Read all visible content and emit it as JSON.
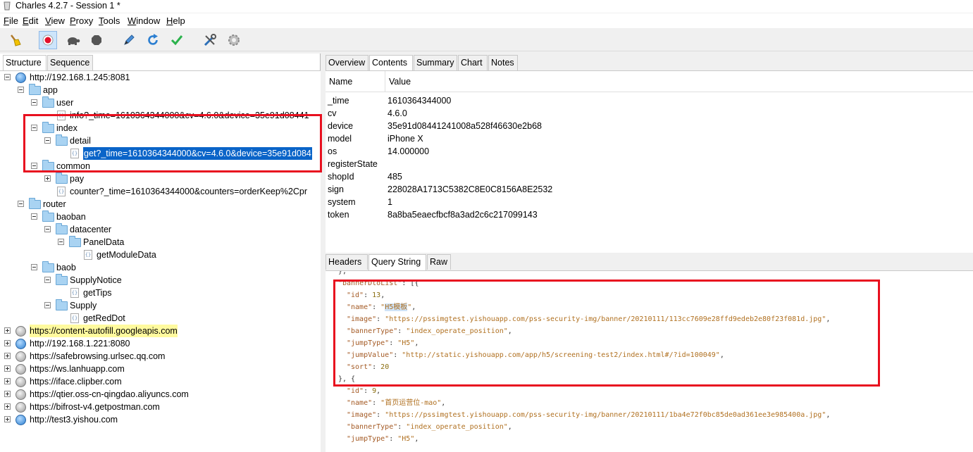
{
  "window": {
    "title": "Charles 4.2.7 - Session 1 *"
  },
  "menu": [
    {
      "mn": "F",
      "rest": "ile"
    },
    {
      "mn": "E",
      "rest": "dit"
    },
    {
      "mn": "V",
      "rest": "iew"
    },
    {
      "mn": "P",
      "rest": "roxy"
    },
    {
      "mn": "T",
      "rest": "ools"
    },
    {
      "mn": "W",
      "rest": "indow"
    },
    {
      "mn": "H",
      "rest": "elp"
    }
  ],
  "toolbar": {
    "icons": [
      "broom-icon",
      "record-icon",
      "turtle-icon",
      "stop-icon",
      "pen-icon",
      "refresh-icon",
      "check-icon",
      "tools-icon",
      "settings-icon"
    ]
  },
  "left_tabs": [
    "Structure",
    "Sequence"
  ],
  "tree": [
    {
      "depth": 0,
      "icon": "globe",
      "exp": "minus",
      "label": "http://192.168.1.245:8081"
    },
    {
      "depth": 1,
      "icon": "folder",
      "exp": "minus",
      "label": "app"
    },
    {
      "depth": 2,
      "icon": "folder",
      "exp": "minus",
      "label": "user"
    },
    {
      "depth": 3,
      "icon": "file",
      "exp": "",
      "label": "info?_time=1610364344000&cv=4.6.0&device=35e91d08441"
    },
    {
      "depth": 2,
      "icon": "folder",
      "exp": "minus",
      "label": "index"
    },
    {
      "depth": 3,
      "icon": "folder",
      "exp": "minus",
      "label": "detail"
    },
    {
      "depth": 4,
      "icon": "file",
      "exp": "",
      "label": "get?_time=1610364344000&cv=4.6.0&device=35e91d084",
      "selected": true
    },
    {
      "depth": 2,
      "icon": "folder",
      "exp": "minus",
      "label": "common"
    },
    {
      "depth": 3,
      "icon": "folder",
      "exp": "plus",
      "label": "pay"
    },
    {
      "depth": 3,
      "icon": "file",
      "exp": "",
      "label": "counter?_time=1610364344000&counters=orderKeep%2Cpr"
    },
    {
      "depth": 1,
      "icon": "folder",
      "exp": "minus",
      "label": "router"
    },
    {
      "depth": 2,
      "icon": "folder",
      "exp": "minus",
      "label": "baoban"
    },
    {
      "depth": 3,
      "icon": "folder",
      "exp": "minus",
      "label": "datacenter"
    },
    {
      "depth": 4,
      "icon": "folder",
      "exp": "minus",
      "label": "PanelData"
    },
    {
      "depth": 5,
      "icon": "file",
      "exp": "",
      "label": "getModuleData"
    },
    {
      "depth": 2,
      "icon": "folder",
      "exp": "minus",
      "label": "baob"
    },
    {
      "depth": 3,
      "icon": "folder",
      "exp": "minus",
      "label": "SupplyNotice"
    },
    {
      "depth": 4,
      "icon": "file",
      "exp": "",
      "label": "getTips"
    },
    {
      "depth": 3,
      "icon": "folder",
      "exp": "minus",
      "label": "Supply"
    },
    {
      "depth": 4,
      "icon": "file",
      "exp": "",
      "label": "getRedDot"
    },
    {
      "depth": 0,
      "icon": "lock",
      "exp": "plus",
      "label": "https://content-autofill.googleapis.com",
      "highlight": true
    },
    {
      "depth": 0,
      "icon": "globe",
      "exp": "plus",
      "label": "http://192.168.1.221:8080"
    },
    {
      "depth": 0,
      "icon": "lock",
      "exp": "plus",
      "label": "https://safebrowsing.urlsec.qq.com"
    },
    {
      "depth": 0,
      "icon": "lock",
      "exp": "plus",
      "label": "https://ws.lanhuapp.com"
    },
    {
      "depth": 0,
      "icon": "lock",
      "exp": "plus",
      "label": "https://iface.clipber.com"
    },
    {
      "depth": 0,
      "icon": "lock",
      "exp": "plus",
      "label": "https://qtier.oss-cn-qingdao.aliyuncs.com"
    },
    {
      "depth": 0,
      "icon": "lock",
      "exp": "plus",
      "label": "https://bifrost-v4.getpostman.com"
    },
    {
      "depth": 0,
      "icon": "globe",
      "exp": "plus",
      "label": "http://test3.yishou.com"
    }
  ],
  "right_tabs": [
    "Overview",
    "Contents",
    "Summary",
    "Chart",
    "Notes"
  ],
  "params_table": {
    "headers": [
      "Name",
      "Value"
    ],
    "rows": [
      [
        "_time",
        "1610364344000"
      ],
      [
        "cv",
        "4.6.0"
      ],
      [
        "device",
        "35e91d08441241008a528f46630e2b68"
      ],
      [
        "model",
        "iPhone X"
      ],
      [
        "os",
        "14.000000"
      ],
      [
        "registerState",
        ""
      ],
      [
        "shopId",
        "485"
      ],
      [
        "sign",
        "228028A1713C5382C8E0C8156A8E2532"
      ],
      [
        "system",
        "1"
      ],
      [
        "token",
        "8a8ba5eaecfbcf8a3ad2c6c217099143"
      ]
    ]
  },
  "bottom_tabs": [
    "Headers",
    "Query String",
    "Raw"
  ],
  "code_lines": [
    {
      "indent": 2,
      "parts": [
        [
          "p",
          "},"
        ]
      ]
    },
    {
      "indent": 2,
      "parts": [
        [
          "k",
          "\"bannerDtoList\""
        ],
        [
          "p",
          ": [{"
        ]
      ]
    },
    {
      "indent": 3,
      "parts": [
        [
          "k",
          "\"id\""
        ],
        [
          "p",
          ": "
        ],
        [
          "n",
          "13"
        ],
        [
          "p",
          ","
        ]
      ]
    },
    {
      "indent": 3,
      "parts": [
        [
          "k",
          "\"name\""
        ],
        [
          "p",
          ": "
        ],
        [
          "s",
          "\""
        ],
        [
          "h",
          "H5模板"
        ],
        [
          "s",
          "\""
        ],
        [
          "p",
          ","
        ]
      ]
    },
    {
      "indent": 3,
      "parts": [
        [
          "k",
          "\"image\""
        ],
        [
          "p",
          ": "
        ],
        [
          "s",
          "\"https://pssimgtest.yishouapp.com/pss-security-img/banner/20210111/113cc7609e28ffd9edeb2e80f23f081d.jpg\""
        ],
        [
          "p",
          ","
        ]
      ]
    },
    {
      "indent": 3,
      "parts": [
        [
          "k",
          "\"bannerType\""
        ],
        [
          "p",
          ": "
        ],
        [
          "s",
          "\"index_operate_position\""
        ],
        [
          "p",
          ","
        ]
      ]
    },
    {
      "indent": 3,
      "parts": [
        [
          "k",
          "\"jumpType\""
        ],
        [
          "p",
          ": "
        ],
        [
          "s",
          "\"H5\""
        ],
        [
          "p",
          ","
        ]
      ]
    },
    {
      "indent": 3,
      "parts": [
        [
          "k",
          "\"jumpValue\""
        ],
        [
          "p",
          ": "
        ],
        [
          "s",
          "\"http://static.yishouapp.com/app/h5/screening-test2/index.html#/?id=100049\""
        ],
        [
          "p",
          ","
        ]
      ]
    },
    {
      "indent": 3,
      "parts": [
        [
          "k",
          "\"sort\""
        ],
        [
          "p",
          ": "
        ],
        [
          "n",
          "20"
        ]
      ]
    },
    {
      "indent": 2,
      "parts": [
        [
          "p",
          "}, {"
        ]
      ]
    },
    {
      "indent": 3,
      "parts": [
        [
          "k",
          "\"id\""
        ],
        [
          "p",
          ": "
        ],
        [
          "n",
          "9"
        ],
        [
          "p",
          ","
        ]
      ]
    },
    {
      "indent": 3,
      "parts": [
        [
          "k",
          "\"name\""
        ],
        [
          "p",
          ": "
        ],
        [
          "s",
          "\"首页运营位-mao\""
        ],
        [
          "p",
          ","
        ]
      ]
    },
    {
      "indent": 3,
      "parts": [
        [
          "k",
          "\"image\""
        ],
        [
          "p",
          ": "
        ],
        [
          "s",
          "\"https://pssimgtest.yishouapp.com/pss-security-img/banner/20210111/1ba4e72f0bc85de0ad361ee3e985400a.jpg\""
        ],
        [
          "p",
          ","
        ]
      ]
    },
    {
      "indent": 3,
      "parts": [
        [
          "k",
          "\"bannerType\""
        ],
        [
          "p",
          ": "
        ],
        [
          "s",
          "\"index_operate_position\""
        ],
        [
          "p",
          ","
        ]
      ]
    },
    {
      "indent": 3,
      "parts": [
        [
          "k",
          "\"jumpType\""
        ],
        [
          "p",
          ": "
        ],
        [
          "s",
          "\"H5\""
        ],
        [
          "p",
          ","
        ]
      ]
    }
  ],
  "colors": {
    "selection": "#0a64c8",
    "highlight": "#fffa9e",
    "annotation": "#e8101f"
  }
}
